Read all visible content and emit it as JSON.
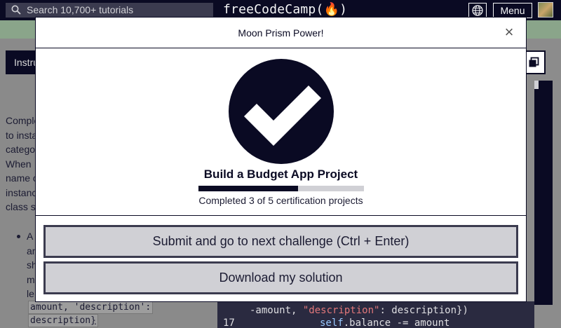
{
  "navbar": {
    "search_placeholder": "Search 10,700+ tutorials",
    "logo": "freeCodeCamp(🔥)",
    "menu_label": "Menu"
  },
  "background": {
    "instructions_tab": "Instructions",
    "description_lines": [
      "Complete",
      "to instan",
      "category",
      "When",
      "name of",
      "instances",
      "class sh"
    ],
    "bullet_lines": [
      "A",
      "an",
      "sh",
      "m",
      "le"
    ],
    "code_inline_1": "amount, 'description':",
    "code_inline_2": "description}",
    "period": ".",
    "code_line_a": {
      "prefix": "-amount, ",
      "string": "\"description\"",
      "suffix": ": description})"
    },
    "code_line_b": {
      "line_no": "17",
      "self": "self",
      "rest": ".balance -= amount"
    }
  },
  "modal": {
    "title": "Moon Prism Power!",
    "close_label": "×",
    "project_title": "Build a Budget App Project",
    "progress": {
      "completed": 3,
      "total": 5
    },
    "progress_text": "Completed 3 of 5 certification projects",
    "submit_button": "Submit and go to next challenge (Ctrl + Enter)",
    "download_button": "Download my solution"
  },
  "colors": {
    "navy": "#0a0a23",
    "button_bg": "#d0d0d5",
    "button_border": "#3b3b4f"
  }
}
